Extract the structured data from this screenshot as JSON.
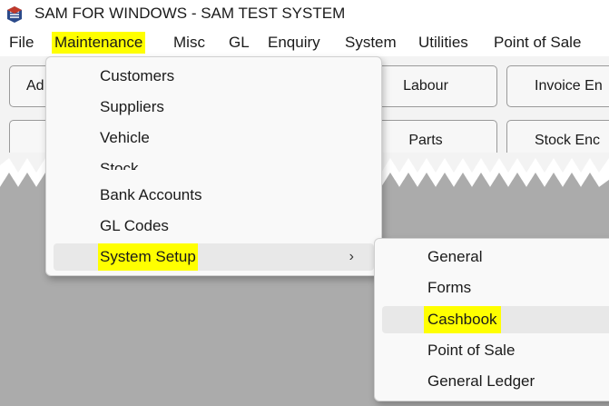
{
  "window": {
    "title": "SAM FOR WINDOWS - SAM TEST SYSTEM",
    "icon": "app-logo-icon"
  },
  "menubar": {
    "file": "File",
    "maintenance": "Maintenance",
    "misc": "Misc",
    "gl": "GL",
    "enquiry": "Enquiry",
    "system": "System",
    "utilities": "Utilities",
    "pos": "Point of Sale"
  },
  "toolbar": {
    "row1": {
      "left": "Ad",
      "mid": "Labour",
      "right": "Invoice En"
    },
    "row2": {
      "left": "",
      "mid": "Parts",
      "right": "Stock Enc"
    }
  },
  "maintenance_menu": {
    "items": [
      "Customers",
      "Suppliers",
      "Vehicle",
      "Stock",
      "Bank Accounts",
      "GL Codes",
      "System Setup"
    ],
    "submenu_arrow": "›"
  },
  "system_setup_menu": {
    "items": [
      "General",
      "Forms",
      "Cashbook",
      "Point of Sale",
      "General Ledger"
    ]
  },
  "colors": {
    "highlight": "#ffff00",
    "workspace": "#ababab",
    "menu_bg": "#f9f9f9"
  }
}
